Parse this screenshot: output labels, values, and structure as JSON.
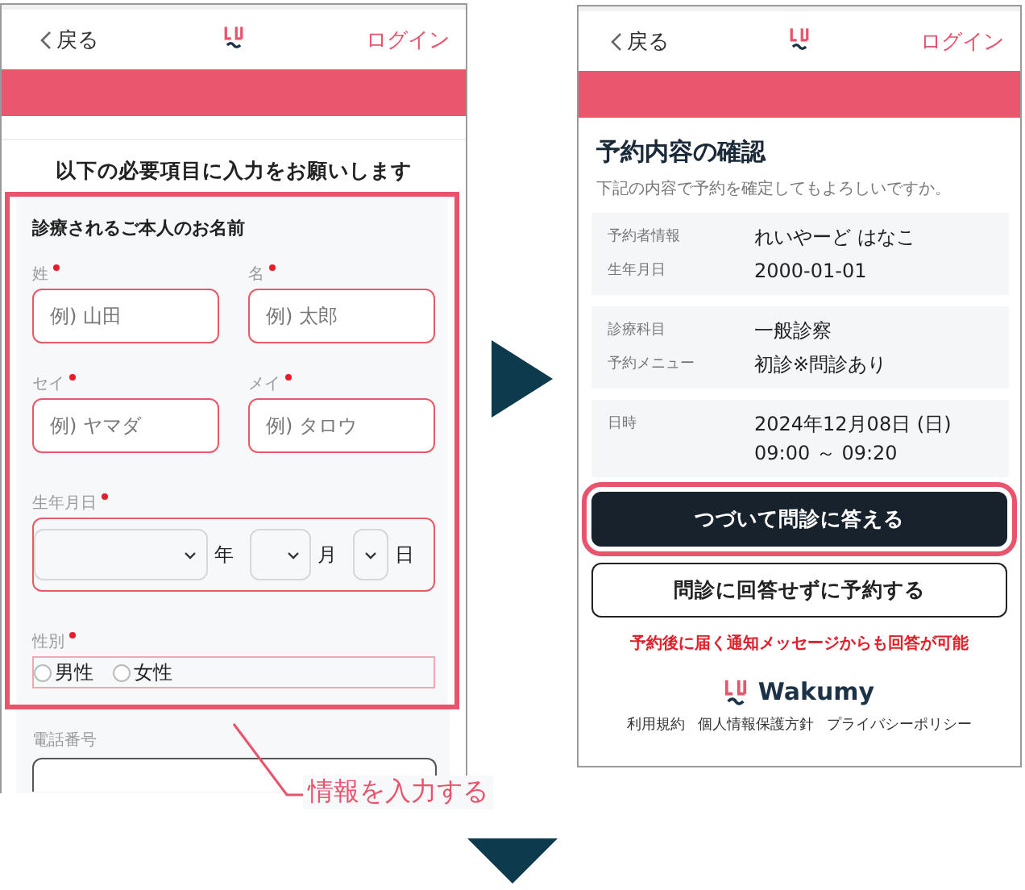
{
  "left_screen": {
    "header": {
      "back": "戻る",
      "login": "ログイン"
    },
    "heading": "以下の必要項目に入力をお願いします",
    "form": {
      "highlighted": true,
      "title": "診療されるご本人のお名前",
      "name_fields": [
        {
          "label": "姓",
          "required": true,
          "placeholder": "例) 山田"
        },
        {
          "label": "名",
          "required": true,
          "placeholder": "例) 太郎"
        },
        {
          "label": "セイ",
          "required": true,
          "placeholder": "例) ヤマダ"
        },
        {
          "label": "メイ",
          "required": true,
          "placeholder": "例) タロウ"
        }
      ],
      "birthdate": {
        "label": "生年月日",
        "required": true,
        "units": [
          "年",
          "月",
          "日"
        ]
      },
      "gender": {
        "label": "性別",
        "required": true,
        "options": [
          {
            "label": "男性",
            "selected": false
          },
          {
            "label": "女性",
            "selected": false
          }
        ]
      }
    },
    "phone": {
      "label": "電話番号"
    }
  },
  "callout": "情報を入力する",
  "right_screen": {
    "header": {
      "back": "戻る",
      "login": "ログイン"
    },
    "title": "予約内容の確認",
    "subtitle": "下記の内容で予約を確定してもよろしいですか。",
    "cards": [
      {
        "rows": [
          {
            "label": "予約者情報",
            "value": [
              "れいやーど はなこ"
            ]
          },
          {
            "label": "生年月日",
            "value": [
              "2000-01-01"
            ]
          }
        ]
      },
      {
        "rows": [
          {
            "label": "診療科目",
            "value": [
              "一般診察"
            ]
          },
          {
            "label": "予約メニュー",
            "value": [
              "初診※問診あり"
            ]
          }
        ]
      },
      {
        "rows": [
          {
            "label": "日時",
            "value": [
              "2024年12月08日 (日)",
              "09:00 ～ 09:20"
            ]
          }
        ]
      }
    ],
    "buttons": [
      {
        "label": "つづいて問診に答える",
        "kind": "primary",
        "highlighted": true
      },
      {
        "label": "問診に回答せずに予約する",
        "kind": "secondary",
        "highlighted": false
      }
    ],
    "note": "予約後に届く通知メッセージからも回答が可能",
    "brand": "Wakumy",
    "footer_links": [
      "利用規約",
      "個人情報保護方針",
      "プライバシーポリシー"
    ]
  }
}
